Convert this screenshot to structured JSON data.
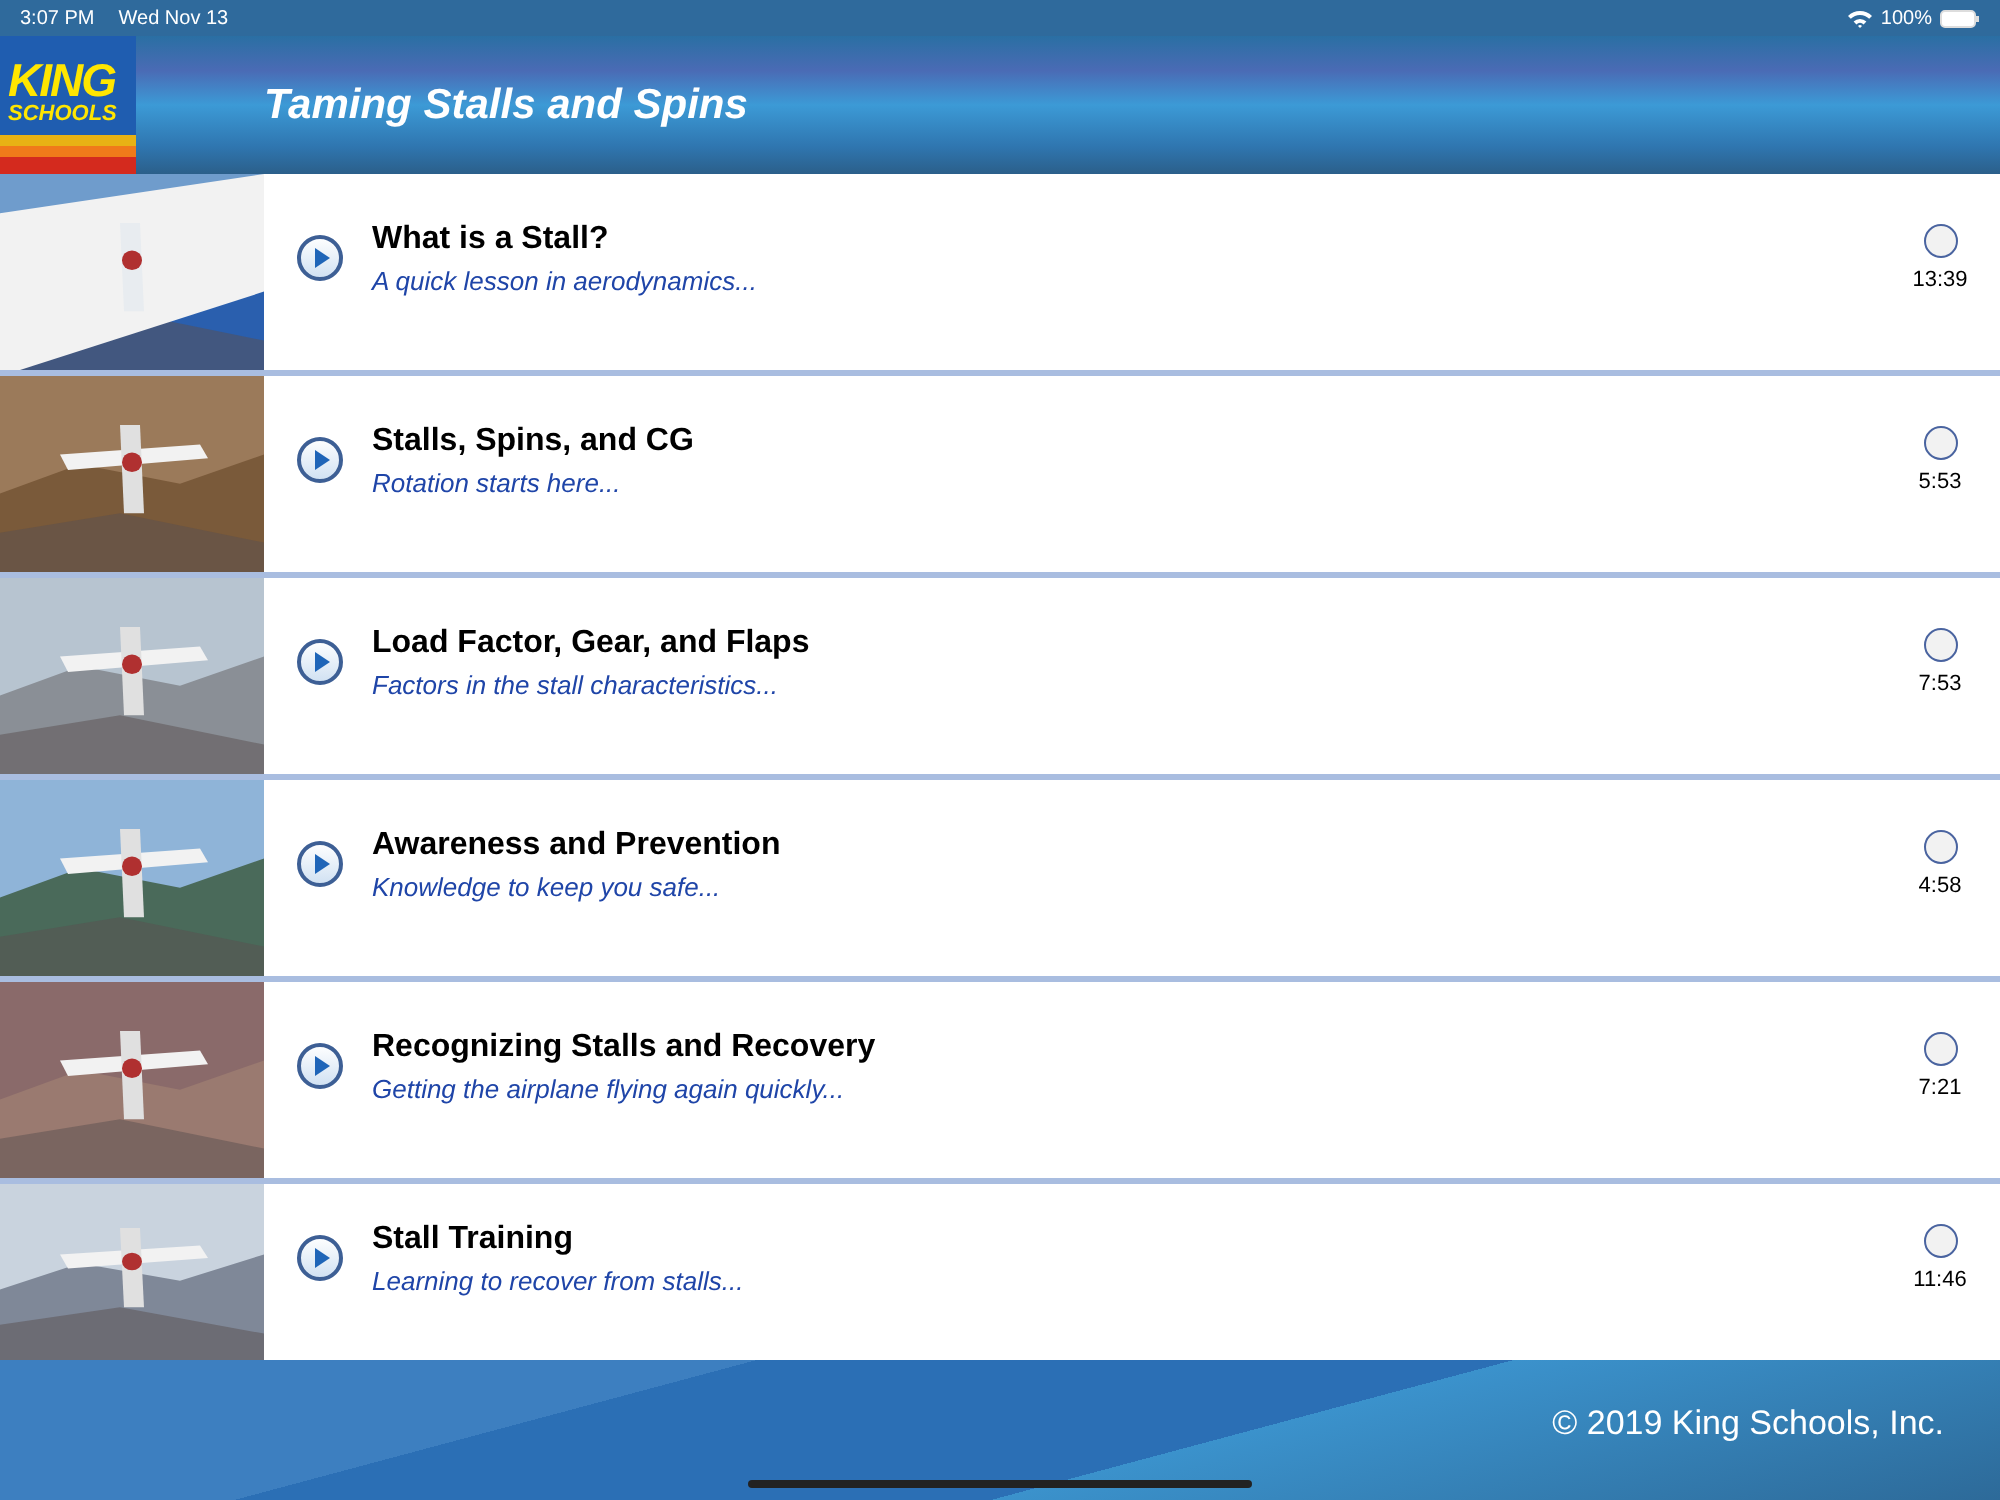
{
  "status_bar": {
    "time": "3:07 PM",
    "date": "Wed Nov 13",
    "battery": "100%"
  },
  "header": {
    "logo": {
      "line_1": "KING",
      "line_2": "SCHOOLS"
    },
    "title": "Taming Stalls and Spins"
  },
  "lessons": [
    {
      "title": "What is a Stall?",
      "subtitle": "A quick lesson in aerodynamics...",
      "duration": "13:39",
      "completed": false
    },
    {
      "title": "Stalls, Spins, and CG",
      "subtitle": "Rotation starts here...",
      "duration": "5:53",
      "completed": false
    },
    {
      "title": "Load Factor, Gear, and Flaps",
      "subtitle": "Factors in the stall characteristics...",
      "duration": "7:53",
      "completed": false
    },
    {
      "title": "Awareness and Prevention",
      "subtitle": "Knowledge to keep you safe...",
      "duration": "4:58",
      "completed": false
    },
    {
      "title": "Recognizing Stalls and Recovery",
      "subtitle": "Getting the airplane flying again quickly...",
      "duration": "7:21",
      "completed": false
    },
    {
      "title": "Stall Training",
      "subtitle": "Learning to recover from stalls...",
      "duration": "11:46",
      "completed": false
    }
  ],
  "footer": {
    "copyright": "© 2019 King Schools, Inc."
  }
}
